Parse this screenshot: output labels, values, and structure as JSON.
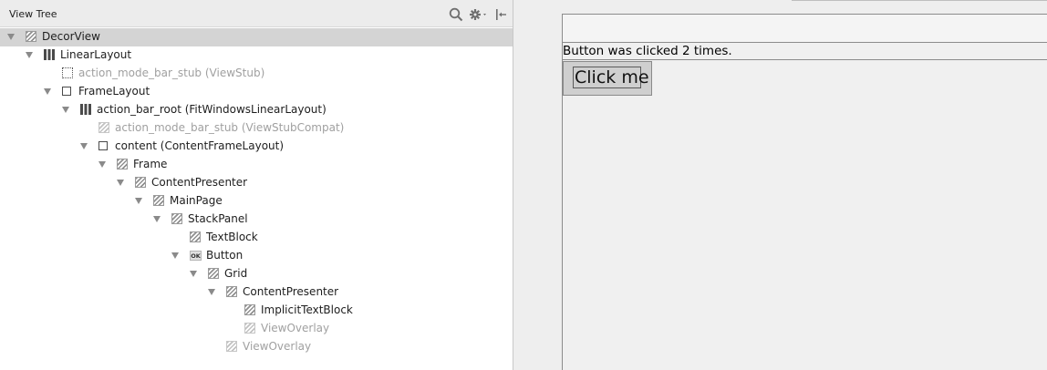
{
  "panel": {
    "title": "View Tree",
    "toolbar": {
      "search_icon": "search-icon",
      "settings_icon": "gear-icon",
      "collapse_icon": "collapse-left-icon"
    }
  },
  "tree": [
    {
      "label": "DecorView",
      "depth": 0,
      "icon": "hatch",
      "expanded": true,
      "selected": true,
      "dim": false
    },
    {
      "label": "LinearLayout",
      "depth": 1,
      "icon": "linear-layout",
      "expanded": true,
      "selected": false,
      "dim": false
    },
    {
      "label": "action_mode_bar_stub (ViewStub)",
      "depth": 2,
      "icon": "view-stub",
      "expanded": null,
      "selected": false,
      "dim": true
    },
    {
      "label": "FrameLayout",
      "depth": 2,
      "icon": "frame-layout",
      "expanded": true,
      "selected": false,
      "dim": false
    },
    {
      "label": "action_bar_root (FitWindowsLinearLayout)",
      "depth": 3,
      "icon": "linear-layout",
      "expanded": true,
      "selected": false,
      "dim": false
    },
    {
      "label": "action_mode_bar_stub (ViewStubCompat)",
      "depth": 4,
      "icon": "hatch",
      "expanded": null,
      "selected": false,
      "dim": true
    },
    {
      "label": "content (ContentFrameLayout)",
      "depth": 4,
      "icon": "frame-layout",
      "expanded": true,
      "selected": false,
      "dim": false
    },
    {
      "label": "Frame",
      "depth": 5,
      "icon": "hatch",
      "expanded": true,
      "selected": false,
      "dim": false
    },
    {
      "label": "ContentPresenter",
      "depth": 6,
      "icon": "hatch",
      "expanded": true,
      "selected": false,
      "dim": false
    },
    {
      "label": "MainPage",
      "depth": 7,
      "icon": "hatch",
      "expanded": true,
      "selected": false,
      "dim": false
    },
    {
      "label": "StackPanel",
      "depth": 8,
      "icon": "hatch",
      "expanded": true,
      "selected": false,
      "dim": false
    },
    {
      "label": "TextBlock",
      "depth": 9,
      "icon": "hatch",
      "expanded": null,
      "selected": false,
      "dim": false
    },
    {
      "label": "Button",
      "depth": 9,
      "icon": "ok-button",
      "expanded": true,
      "selected": false,
      "dim": false
    },
    {
      "label": "Grid",
      "depth": 10,
      "icon": "hatch",
      "expanded": true,
      "selected": false,
      "dim": false
    },
    {
      "label": "ContentPresenter",
      "depth": 11,
      "icon": "hatch",
      "expanded": true,
      "selected": false,
      "dim": false
    },
    {
      "label": "ImplicitTextBlock",
      "depth": 12,
      "icon": "hatch",
      "expanded": null,
      "selected": false,
      "dim": false
    },
    {
      "label": "ViewOverlay",
      "depth": 12,
      "icon": "hatch",
      "expanded": null,
      "selected": false,
      "dim": true
    },
    {
      "label": "ViewOverlay",
      "depth": 11,
      "icon": "hatch",
      "expanded": null,
      "selected": false,
      "dim": true
    }
  ],
  "ok_badge": "OK",
  "preview": {
    "status_text": "Button was clicked 2 times.",
    "button_label": "Click me"
  }
}
